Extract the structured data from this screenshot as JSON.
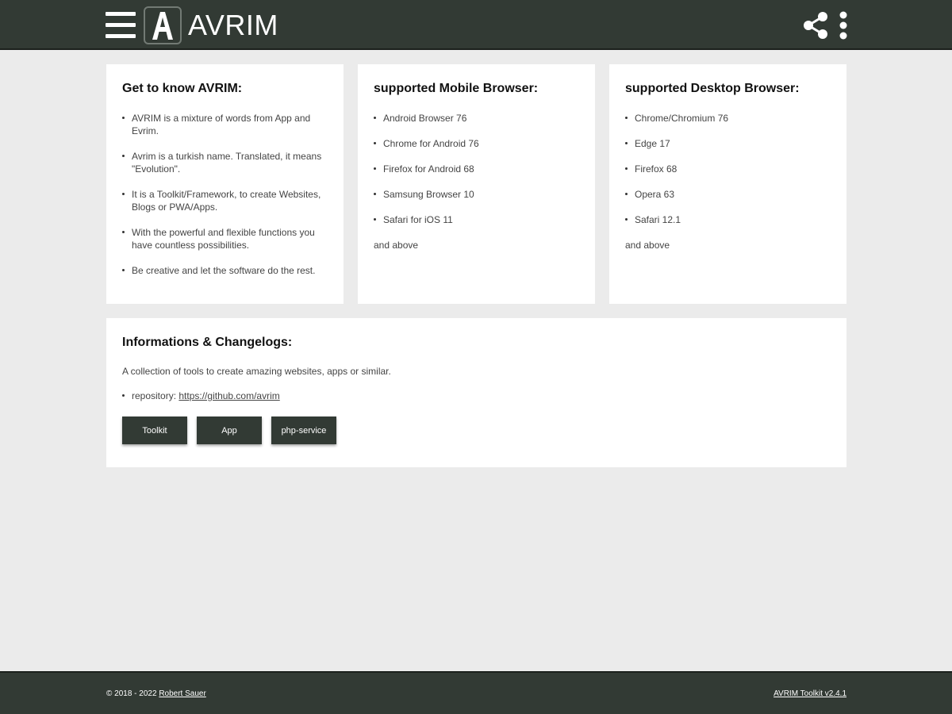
{
  "header": {
    "title": "AVRIM",
    "logo_letter": "A",
    "menu_icon": "hamburger-menu-icon",
    "share_icon": "share-icon",
    "more_icon": "more-vertical-icon"
  },
  "cards": {
    "about": {
      "title": "Get to know AVRIM:",
      "items": [
        "AVRIM is a mixture of words from App and Evrim.",
        "Avrim is a turkish name. Translated, it means \"Evolution\".",
        "It is a Toolkit/Framework, to create Websites, Blogs or PWA/Apps.",
        "With the powerful and flexible functions you have countless possibilities.",
        "Be creative and let the software do the rest."
      ]
    },
    "mobile": {
      "title": "supported Mobile Browser:",
      "items": [
        "Android Browser 76",
        "Chrome for Android 76",
        "Firefox for Android 68",
        "Samsung Browser 10",
        "Safari for iOS 11"
      ],
      "tail": "and above"
    },
    "desktop": {
      "title": "supported Desktop Browser:",
      "items": [
        "Chrome/Chromium 76",
        "Edge 17",
        "Firefox 68",
        "Opera 63",
        "Safari 12.1"
      ],
      "tail": "and above"
    }
  },
  "info": {
    "title": "Informations & Changelogs:",
    "description": "A collection of tools to create amazing websites, apps or similar.",
    "repo_label": "repository:",
    "repo_link": "https://github.com/avrim",
    "buttons": [
      "Toolkit",
      "App",
      "php-service"
    ]
  },
  "footer": {
    "copyright": "© 2018 - 2022",
    "author": "Robert Sauer",
    "version": "AVRIM Toolkit v2.4.1"
  },
  "colors": {
    "bar": "#323a34",
    "background": "#ebebeb",
    "card": "#ffffff"
  }
}
